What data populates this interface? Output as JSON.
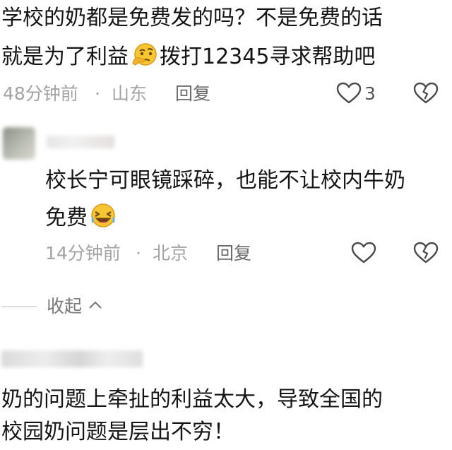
{
  "comment1": {
    "line1": "学校的奶都是免费发的吗？不是免费的话",
    "line2_a": "就是为了利益",
    "line2_emoji": "thinking-face-emoji",
    "line2_b": "拨打12345寻求帮助吧",
    "time": "48分钟前",
    "sep": "·",
    "location": "山东",
    "reply_label": "回复",
    "like_count": "3"
  },
  "reply1": {
    "line1": "校长宁可眼镜踩碎，也能不让校内牛奶",
    "line2": "免费",
    "line2_emoji": "laughing-face-emoji",
    "time": "14分钟前",
    "sep": "·",
    "location": "北京",
    "reply_label": "回复"
  },
  "collapse": {
    "label": "收起"
  },
  "comment2": {
    "line1": "奶的问题上牵扯的利益太大，导致全国的",
    "line2": "校园奶问题是层出不穷！"
  },
  "colors": {
    "text": "#151515",
    "meta": "#a3a3a3",
    "reply": "#6b6b6b",
    "icon": "#4a4a4a",
    "emoji": "#f7c531"
  }
}
